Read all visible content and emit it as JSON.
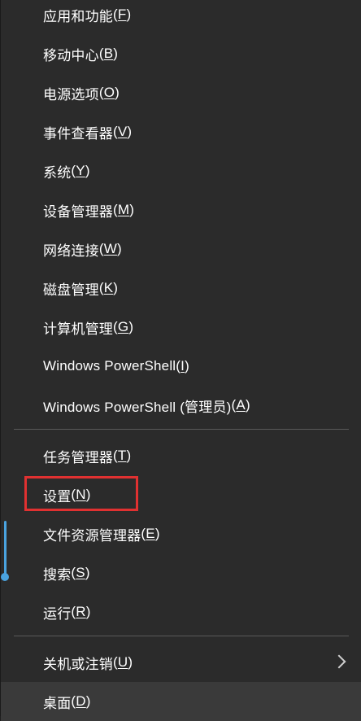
{
  "menu": {
    "group1": [
      {
        "label": "应用和功能",
        "key": "F"
      },
      {
        "label": "移动中心",
        "key": "B"
      },
      {
        "label": "电源选项",
        "key": "O"
      },
      {
        "label": "事件查看器",
        "key": "V"
      },
      {
        "label": "系统",
        "key": "Y"
      },
      {
        "label": "设备管理器",
        "key": "M"
      },
      {
        "label": "网络连接",
        "key": "W"
      },
      {
        "label": "磁盘管理",
        "key": "K"
      },
      {
        "label": "计算机管理",
        "key": "G"
      },
      {
        "label": "Windows PowerShell",
        "key": "I"
      },
      {
        "label": "Windows PowerShell (管理员)",
        "key": "A"
      }
    ],
    "group2": [
      {
        "label": "任务管理器",
        "key": "T"
      },
      {
        "label": "设置",
        "key": "N"
      },
      {
        "label": "文件资源管理器",
        "key": "E"
      },
      {
        "label": "搜索",
        "key": "S"
      },
      {
        "label": "运行",
        "key": "R"
      }
    ],
    "group3": [
      {
        "label": "关机或注销",
        "key": "U",
        "submenu_icon": "chevron-right-icon"
      },
      {
        "label": "桌面",
        "key": "D"
      }
    ]
  },
  "highlight": {
    "target": "设置(N)",
    "color": "#e03131"
  },
  "colors": {
    "menu_background": "#2b2b2b",
    "text": "#ffffff",
    "separator": "#5a5a5a",
    "hover_background": "#3a3a3a"
  }
}
